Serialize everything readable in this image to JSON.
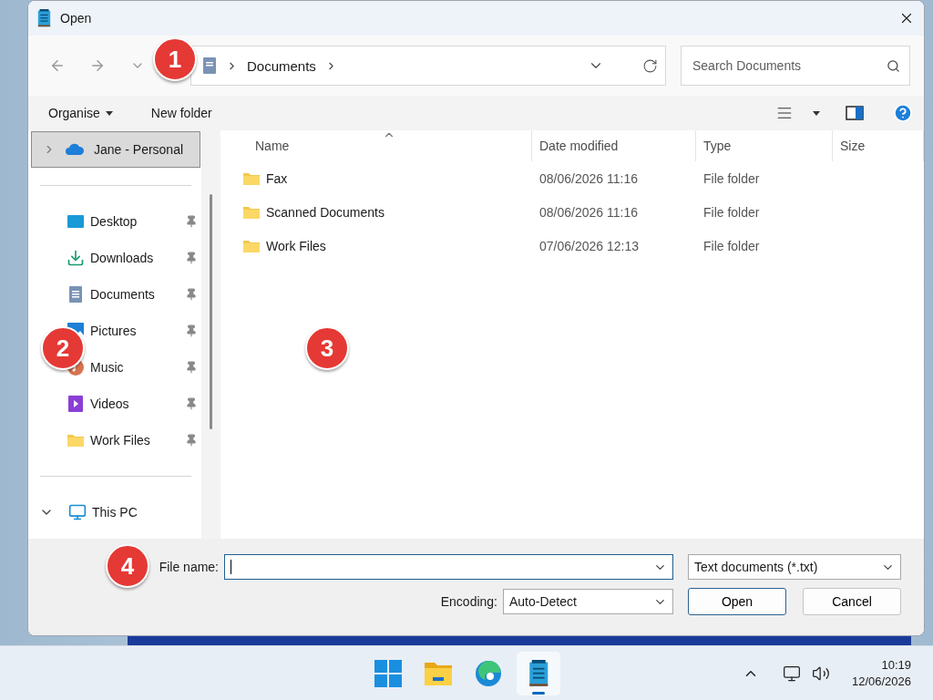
{
  "window": {
    "title": "Open"
  },
  "navigation": {
    "breadcrumb": [
      "Documents"
    ],
    "search": {
      "placeholder": "Search Documents"
    }
  },
  "toolbar": {
    "items": [
      "Organise",
      "New folder"
    ]
  },
  "sidebar": {
    "top": {
      "label": "Jane - Personal",
      "selected": true,
      "expanded": false
    },
    "quick_access": [
      {
        "label": "Desktop",
        "kind": "desktop",
        "pinned": true
      },
      {
        "label": "Downloads",
        "kind": "download",
        "pinned": true
      },
      {
        "label": "Documents",
        "kind": "document",
        "pinned": true
      },
      {
        "label": "Pictures",
        "kind": "pictures",
        "pinned": true
      },
      {
        "label": "Music",
        "kind": "music",
        "pinned": true
      },
      {
        "label": "Videos",
        "kind": "videos",
        "pinned": true
      },
      {
        "label": "Work Files",
        "kind": "folder",
        "pinned": true
      }
    ],
    "bottom": {
      "label": "This PC",
      "expanded": true
    }
  },
  "table": {
    "columns": [
      "Name",
      "Date modified",
      "Type",
      "Size"
    ],
    "rows": [
      {
        "name": "Fax",
        "date": "08/06/2026 11:16",
        "type": "File folder"
      },
      {
        "name": "Scanned Documents",
        "date": "08/06/2026 11:16",
        "type": "File folder"
      },
      {
        "name": "Work Files",
        "date": "07/06/2026 12:13",
        "type": "File folder"
      }
    ]
  },
  "footer": {
    "file_name_label": "File name:",
    "filter": "Text documents (*.txt)",
    "encoding_label": "Encoding:",
    "encoding": "Auto-Detect",
    "buttons": [
      "Open",
      "Cancel"
    ]
  },
  "callouts": [
    "1",
    "2",
    "3",
    "4"
  ],
  "taskbar": {
    "apps": [
      {
        "kind": "start",
        "selected": false
      },
      {
        "kind": "explorer",
        "selected": false
      },
      {
        "kind": "edge",
        "selected": false
      },
      {
        "kind": "notepad",
        "selected": true
      }
    ],
    "time": "10:19",
    "date": "12/06/2026"
  }
}
